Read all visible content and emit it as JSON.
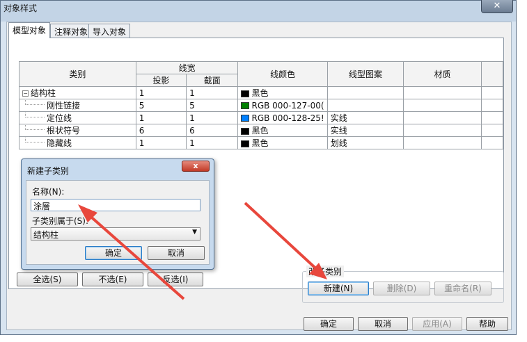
{
  "window": {
    "title": "对象样式",
    "close": "✕"
  },
  "tabs": [
    "模型对象",
    "注释对象",
    "导入对象"
  ],
  "table": {
    "headers": {
      "category": "类别",
      "line_weight": "线宽",
      "projection": "投影",
      "cut": "截面",
      "line_color": "线颜色",
      "line_pattern": "线型图案",
      "material": "材质"
    },
    "rows": [
      {
        "name": "结构柱",
        "toggle": "−",
        "proj": "1",
        "cut": "1",
        "color_hex": "#000000",
        "color": "黑色",
        "pattern": "",
        "material": ""
      },
      {
        "name": "刚性链接",
        "proj": "5",
        "cut": "5",
        "color_hex": "#008000",
        "color": "RGB 000-127-00(",
        "pattern": "",
        "material": ""
      },
      {
        "name": "定位线",
        "proj": "1",
        "cut": "1",
        "color_hex": "#0080ff",
        "color": "RGB 000-128-25!",
        "pattern": "实线",
        "material": ""
      },
      {
        "name": "根状符号",
        "proj": "6",
        "cut": "6",
        "color_hex": "#000000",
        "color": "黑色",
        "pattern": "实线",
        "material": ""
      },
      {
        "name": "隐藏线",
        "proj": "1",
        "cut": "1",
        "color_hex": "#000000",
        "color": "黑色",
        "pattern": "划线",
        "material": ""
      }
    ]
  },
  "select_buttons": {
    "all": "全选(S)",
    "none": "不选(E)",
    "invert": "反选(I)"
  },
  "modify_group": {
    "title": "修改子类别",
    "visible_title": "改子类别",
    "new": "新建(N)",
    "delete": "删除(D)",
    "rename": "重命名(R)"
  },
  "footer": {
    "ok": "确定",
    "cancel": "取消",
    "apply": "应用(A)",
    "help": "帮助"
  },
  "dialog": {
    "title": "新建子类别",
    "close": "x",
    "name_label": "名称(N):",
    "name_value": "涂層",
    "parent_label": "子类别属于(S):",
    "parent_value": "结构柱",
    "ok": "确定",
    "cancel": "取消"
  },
  "annotation_color": "#e8473c"
}
